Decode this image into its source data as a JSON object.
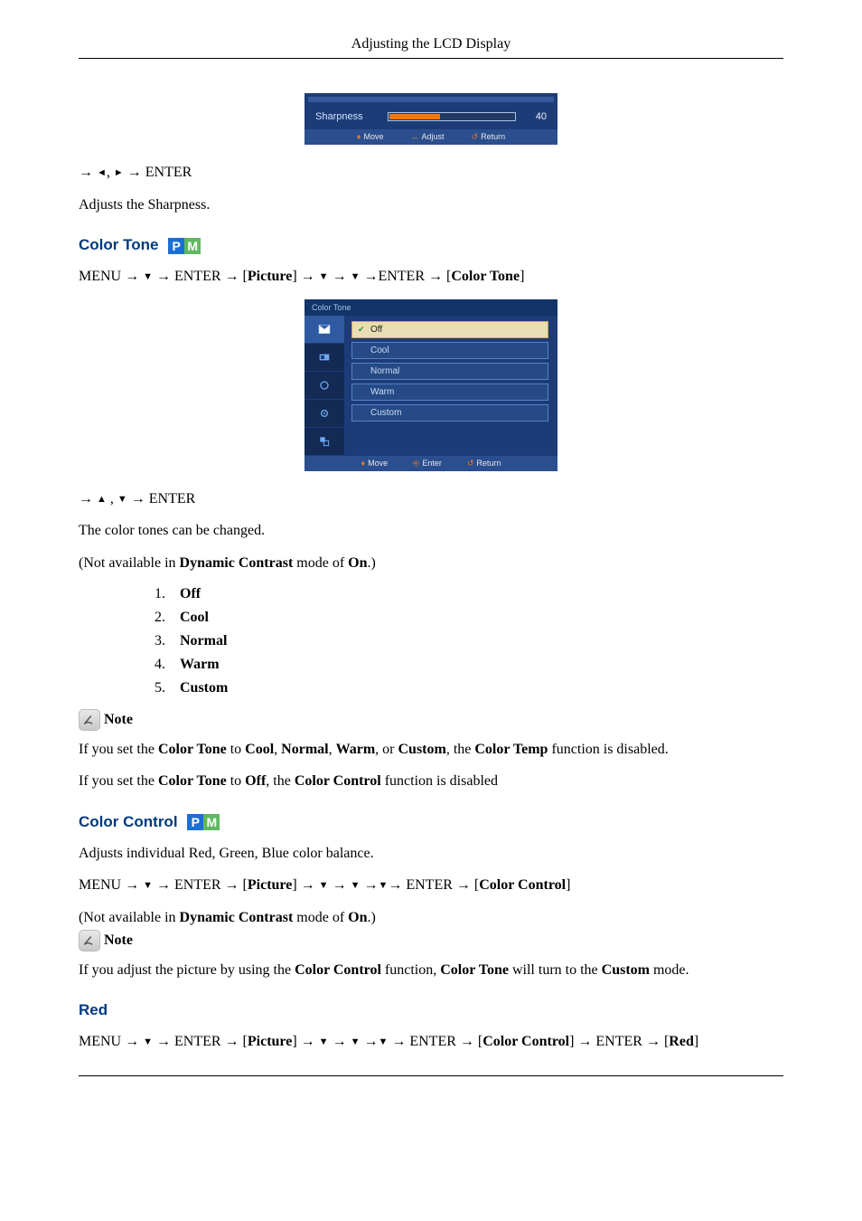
{
  "header": {
    "title": "Adjusting the LCD Display"
  },
  "pm_badge": {
    "p": "P",
    "m": "M"
  },
  "sharpness": {
    "osd": {
      "label": "Sharpness",
      "value": "40",
      "foot": {
        "move": "Move",
        "adjust": "Adjust",
        "return": "Return"
      }
    },
    "nav": {
      "arrow": "→",
      "left": "◄",
      "comma": ",",
      "right": "►",
      "enter": " ENTER"
    },
    "desc": "Adjusts the Sharpness."
  },
  "colorTone": {
    "title": "Color Tone",
    "navLine": {
      "menu": "MENU ",
      "arrow": "→ ",
      "down": "▼",
      "enter": " ENTER ",
      "picture": "Picture",
      "lbracket": "[",
      "rbracket": "]",
      "ct": "Color Tone"
    },
    "osd": {
      "title": "Color Tone",
      "options": [
        "Off",
        "Cool",
        "Normal",
        "Warm",
        "Custom"
      ],
      "selectedIndex": 0,
      "foot": {
        "move": "Move",
        "enter": "Enter",
        "return": "Return"
      }
    },
    "nav2": {
      "arrow": "→",
      "up": "▲",
      "sep": " , ",
      "down": "▼",
      "enter": " ENTER"
    },
    "desc": "The color tones can be changed.",
    "notAvail": {
      "pre": "(Not available in ",
      "dc": "Dynamic Contrast",
      "mid": " mode of ",
      "on": "On",
      "post": ".)"
    },
    "listItems": [
      "Off",
      "Cool",
      "Normal",
      "Warm",
      "Custom"
    ],
    "noteLabel": "Note",
    "note1": {
      "pre": "If you set the ",
      "ct": "Color Tone",
      "to": " to ",
      "cool": "Cool",
      "c1": ", ",
      "normal": "Normal",
      "c2": ", ",
      "warm": "Warm",
      "or": ", or ",
      "custom": "Custom",
      "mid": ", the ",
      "ctemp": "Color Temp",
      "post": " function is disabled."
    },
    "note2": {
      "pre": "If you set the ",
      "ct": "Color Tone",
      "to": " to ",
      "off": "Off",
      "mid": ", the ",
      "cc": "Color Control",
      "post": " function is disabled"
    }
  },
  "colorControl": {
    "title": "Color Control",
    "desc": "Adjusts individual Red, Green, Blue color balance.",
    "navLine": {
      "menu": "MENU ",
      "arrow": "→ ",
      "down": "▼",
      "enter": " ENTER ",
      "picture": "Picture",
      "lbracket": "[",
      "rbracket": "]",
      "cc": "Color Control"
    },
    "notAvail": {
      "pre": "(Not available in ",
      "dc": "Dynamic Contrast",
      "mid": " mode of ",
      "on": "On",
      "post": ".)"
    },
    "noteLabel": "Note",
    "note": {
      "pre": "If you adjust the picture by using the ",
      "cc": "Color Control",
      "mid": " function, ",
      "ct": "Color Tone",
      "mid2": " will turn to the ",
      "custom": "Custom",
      "post": " mode."
    }
  },
  "red": {
    "title": "Red",
    "navLine": {
      "menu": "MENU ",
      "arrow": "→ ",
      "down": "▼",
      "enter": " ENTER ",
      "picture": "Picture",
      "lbracket": "[",
      "rbracket": "]",
      "cc": "Color Control",
      "red": "Red"
    }
  }
}
